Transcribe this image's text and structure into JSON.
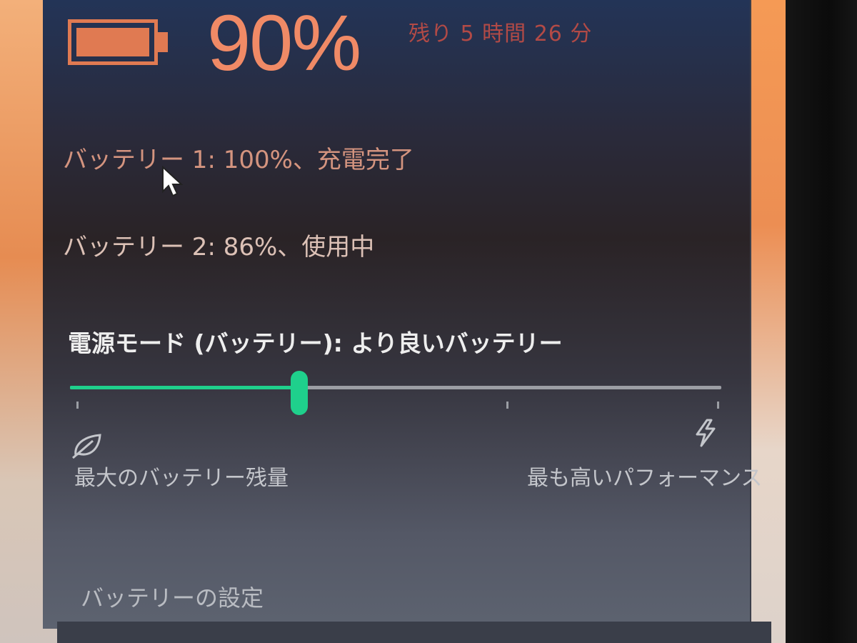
{
  "battery": {
    "percent_text": "90%",
    "percent_value": 90,
    "time_remaining": "残り 5 時間 26 分",
    "battery1_status": "バッテリー 1: 100%、充電完了",
    "battery2_status": "バッテリー 2: 86%、使用中",
    "icon": "battery-icon"
  },
  "power_mode": {
    "label": "電源モード (バッテリー): より良いバッテリー",
    "slider_position_fraction": 0.35,
    "left_label": "最大のバッテリー残量",
    "right_label": "最も高いパフォーマンス",
    "left_icon": "leaf-icon",
    "right_icon": "lightning-bolt-icon"
  },
  "links": {
    "battery_settings": "バッテリーの設定"
  },
  "colors": {
    "accent": "#1fd08c",
    "battery_orange": "#e07a52",
    "panel_bg": "#2a2a3a"
  }
}
